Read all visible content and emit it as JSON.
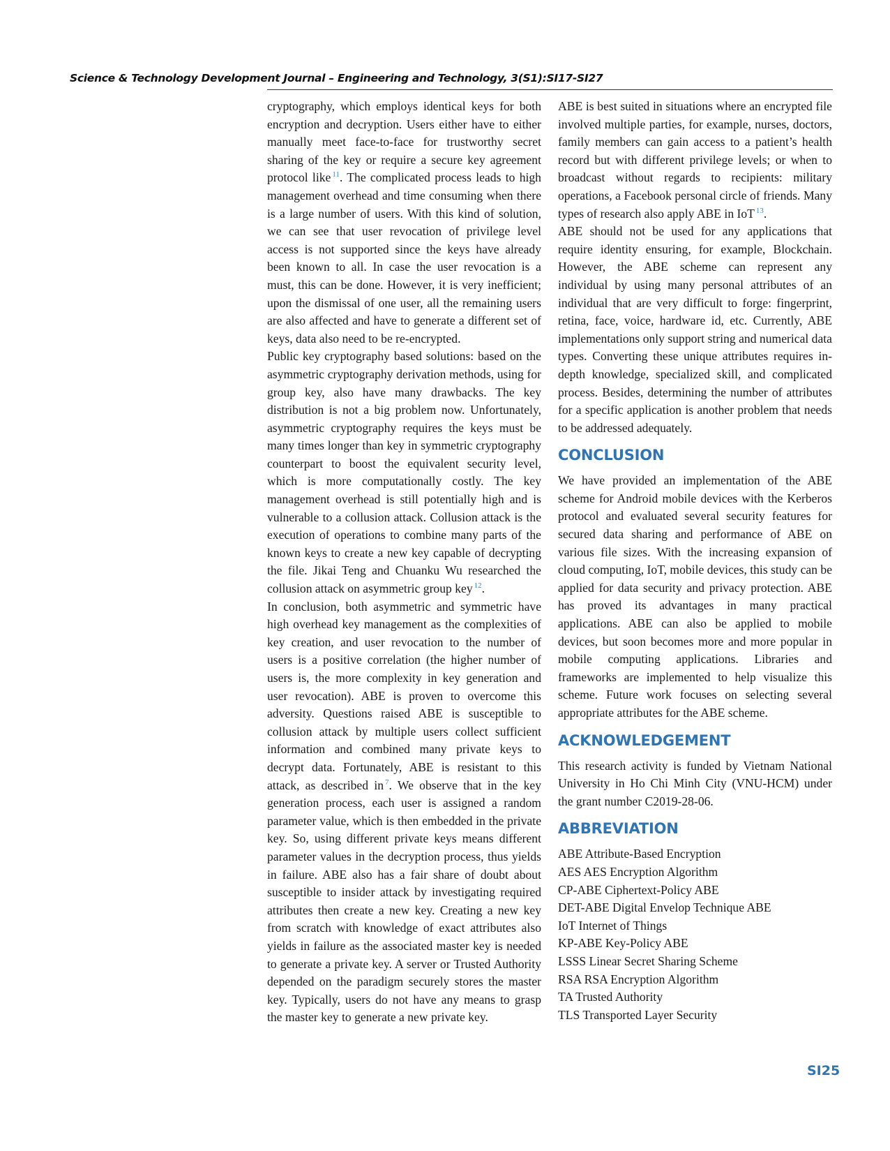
{
  "header": {
    "running_head": "Science & Technology Development Journal – Engineering and Technology, 3(S1):SI17-SI27"
  },
  "left_column": {
    "p1": {
      "a": "cryptography, which employs identical keys for both encryption and decryption.  Users either have to either manually meet face-to-face for trustworthy secret sharing of the key or require a secure key agreement protocol like",
      "ref": "11",
      "b": ".  The complicated process leads to high management overhead and time consuming when there is a large number of users. With this kind of solution, we can see that user revocation of privilege level access is not supported since the keys have already been known to all.  In case the user revocation is a must, this can be done.  However, it is very inefficient; upon the dismissal of one user, all the remaining users are also affected and have to generate a different set of keys, data also need to be re-encrypted."
    },
    "p2": {
      "a": "Public key cryptography based solutions:  based on the asymmetric cryptography derivation methods, using for group key, also have many drawbacks.  The key distribution is not a big problem now.  Unfortunately, asymmetric cryptography requires the keys must be many times longer than key in symmetric cryptography counterpart to boost the equivalent security level, which is more computationally costly. The key management overhead is still potentially high and is vulnerable to a collusion attack.  Collusion attack is the execution of operations to combine many parts of the known keys to create a new key capable of decrypting the file.  Jikai Teng and Chuanku Wu researched the collusion attack on asymmetric group key",
      "ref": "12",
      "b": "."
    },
    "p3": {
      "a": "In conclusion, both asymmetric and symmetric have high overhead key management as the complexities of key creation, and user revocation to the number of users is a positive correlation (the higher number of users is, the more complexity in key generation and user revocation). ABE is proven to overcome this adversity.  Questions raised ABE is susceptible to collusion attack by multiple users collect sufficient information and combined many private keys to decrypt data.  Fortunately, ABE is resistant to this attack, as described in",
      "ref": "7",
      "b": ".  We observe that in the key generation process, each user is assigned a random parameter value, which is then embedded in the private key. So, using different private keys means different parameter values in the decryption process, thus yields in failure. ABE also has a fair share of doubt about susceptible to insider attack by investigating required attributes then create a new key.  Creating a new key from scratch with knowledge of exact attributes also yields in failure as the associated master key is needed to generate a private key.  A server or Trusted Authority depended on the paradigm securely stores the master key.  Typically, users do not have any means to grasp the master key to generate a new private key."
    }
  },
  "right_column": {
    "p1": {
      "a": "ABE is best suited in situations where an encrypted file involved multiple parties, for example, nurses, doctors, family members can gain access to a patient’s health record but with different privilege levels; or when to broadcast without regards to recipients: military operations, a Facebook personal circle of friends. Many types of research also apply ABE in IoT",
      "ref": "13",
      "b": "."
    },
    "p2": "ABE should not be used for any applications that require identity ensuring, for example, Blockchain. However, the ABE scheme can represent any individual by using many personal attributes of an individual that are very difficult to forge: fingerprint, retina, face, voice, hardware id, etc.  Currently, ABE implementations only support string and numerical data types. Converting these unique attributes requires in-depth knowledge, specialized skill, and complicated process. Besides, determining the number of attributes for a specific application is another problem that needs to be addressed adequately.",
    "conclusion": {
      "heading": "CONCLUSION",
      "text": "We have provided an implementation of the ABE scheme for Android mobile devices with the Kerberos protocol and evaluated several security features for secured data sharing and performance of ABE on various file sizes.  With the increasing expansion of cloud computing, IoT, mobile devices, this study can be applied for data security and privacy protection.  ABE has proved its advantages in many practical applications.  ABE can also be applied to mobile devices, but soon becomes more and more popular in mobile computing applications.  Libraries and frameworks are implemented to help visualize this scheme.  Future work focuses on selecting several appropriate attributes for the ABE scheme."
    },
    "acknowledgement": {
      "heading": "ACKNOWLEDGEMENT",
      "text": "This research activity is funded by Vietnam National University in Ho Chi Minh City (VNU-HCM) under the grant number C2019-28-06."
    },
    "abbreviation": {
      "heading": "ABBREVIATION",
      "items": [
        "ABE Attribute-Based Encryption",
        "AES AES Encryption Algorithm",
        "CP-ABE Ciphertext-Policy ABE",
        "DET-ABE Digital Envelop Technique ABE",
        "IoT Internet of Things",
        "KP-ABE Key-Policy ABE",
        "LSSS Linear Secret Sharing Scheme",
        "RSA RSA Encryption Algorithm",
        "TA Trusted Authority",
        "TLS Transported Layer Security"
      ]
    }
  },
  "footer": {
    "page_number": "SI25"
  },
  "colors": {
    "heading_blue": "#2f74b5",
    "reference_blue": "#3a87c8"
  }
}
